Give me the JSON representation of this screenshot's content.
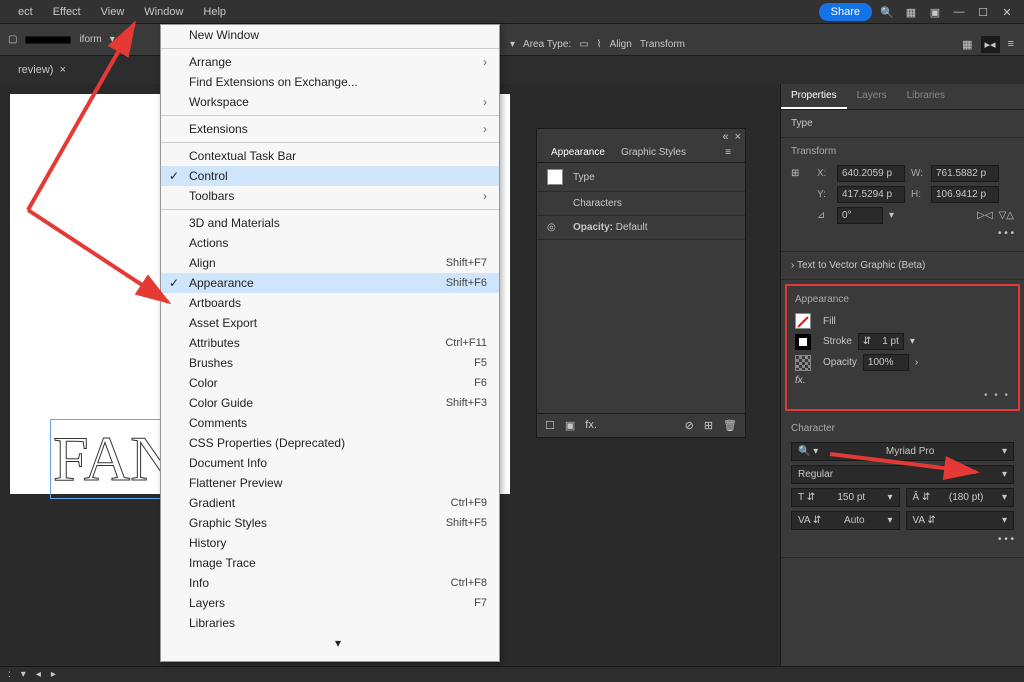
{
  "menubar": {
    "items": [
      "ect",
      "Effect",
      "View",
      "Window",
      "Help"
    ]
  },
  "share": "Share",
  "controlbar": {
    "transform": "iform",
    "area_type": "Area Type:",
    "align": "Align",
    "transform2": "Transform"
  },
  "doctab": {
    "name": "review)",
    "close": "×"
  },
  "canvas_text": "FAN",
  "dropdown": {
    "sections": [
      [
        {
          "label": "New Window"
        }
      ],
      [
        {
          "label": "Arrange",
          "sub": true
        },
        {
          "label": "Find Extensions on Exchange..."
        },
        {
          "label": "Workspace",
          "sub": true
        }
      ],
      [
        {
          "label": "Extensions",
          "sub": true
        }
      ],
      [
        {
          "label": "Contextual Task Bar"
        },
        {
          "label": "Control",
          "checked": true
        },
        {
          "label": "Toolbars",
          "sub": true
        }
      ],
      [
        {
          "label": "3D and Materials"
        },
        {
          "label": "Actions"
        },
        {
          "label": "Align",
          "shortcut": "Shift+F7"
        },
        {
          "label": "Appearance",
          "shortcut": "Shift+F6",
          "checked": true
        },
        {
          "label": "Artboards"
        },
        {
          "label": "Asset Export"
        },
        {
          "label": "Attributes",
          "shortcut": "Ctrl+F11"
        },
        {
          "label": "Brushes",
          "shortcut": "F5"
        },
        {
          "label": "Color",
          "shortcut": "F6"
        },
        {
          "label": "Color Guide",
          "shortcut": "Shift+F3"
        },
        {
          "label": "Comments"
        },
        {
          "label": "CSS Properties (Deprecated)"
        },
        {
          "label": "Document Info"
        },
        {
          "label": "Flattener Preview"
        },
        {
          "label": "Gradient",
          "shortcut": "Ctrl+F9"
        },
        {
          "label": "Graphic Styles",
          "shortcut": "Shift+F5"
        },
        {
          "label": "History"
        },
        {
          "label": "Image Trace"
        },
        {
          "label": "Info",
          "shortcut": "Ctrl+F8"
        },
        {
          "label": "Layers",
          "shortcut": "F7"
        },
        {
          "label": "Libraries"
        }
      ]
    ]
  },
  "appearance_panel": {
    "tabs": [
      "Appearance",
      "Graphic Styles"
    ],
    "rows": [
      {
        "label": "Type"
      },
      {
        "label": "Characters"
      },
      {
        "label": "Opacity:",
        "value": "Default"
      }
    ]
  },
  "rightpanel": {
    "tabs": [
      "Properties",
      "Layers",
      "Libraries"
    ],
    "type_label": "Type",
    "transform": {
      "title": "Transform",
      "x": "640.2059 p",
      "w": "761.5882 p",
      "y": "417.5294 p",
      "h": "106.9412 p",
      "angle": "0°"
    },
    "t2v": "Text to Vector Graphic (Beta)",
    "appearance": {
      "title": "Appearance",
      "fill": "Fill",
      "stroke": "Stroke",
      "stroke_val": "1 pt",
      "opacity": "Opacity",
      "opacity_val": "100%",
      "fx": "fx.",
      "more": "• • •"
    },
    "character": {
      "title": "Character",
      "font": "Myriad Pro",
      "style": "Regular",
      "size": "150 pt",
      "leading": "(180 pt)",
      "kerning": "Auto",
      "tracking": ""
    }
  },
  "more": "• • •"
}
